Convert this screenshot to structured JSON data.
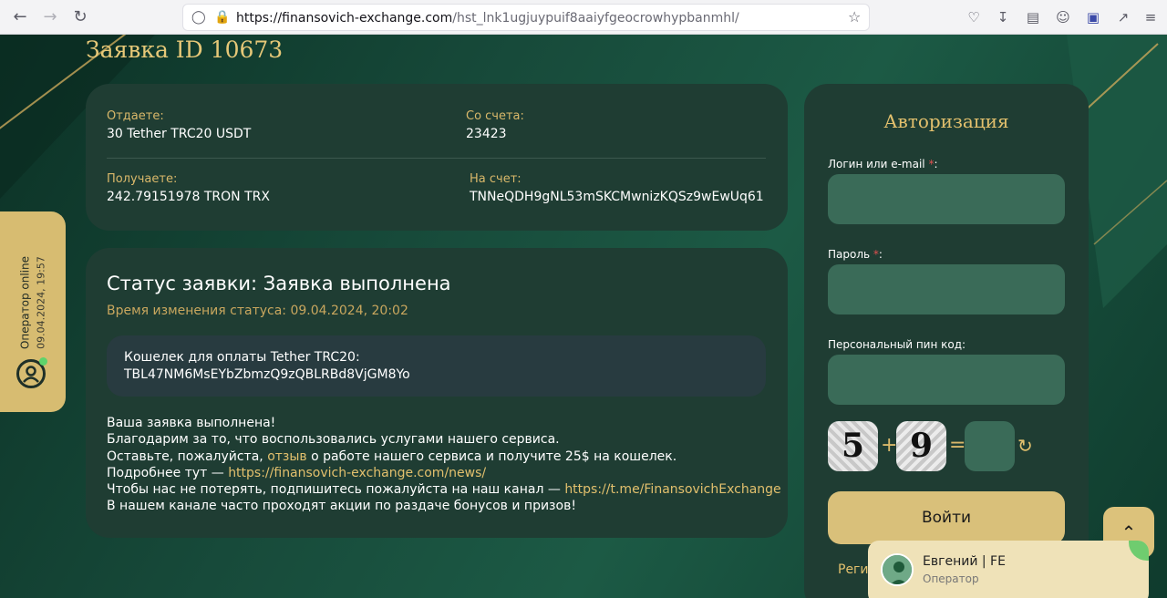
{
  "browser": {
    "url_host": "https://finansovich-exchange.com",
    "url_path": "/hst_lnk1ugjuypuif8aaiyfgeocrowhypbanmhl/"
  },
  "order": {
    "title": "Заявка ID 10673",
    "give_label": "Отдаете:",
    "give_value": "30 Tether TRC20 USDT",
    "from_account_label": "Со счета:",
    "from_account_value": "23423",
    "receive_label": "Получаете:",
    "receive_value": "242.79151978 TRON TRX",
    "to_account_label": "На счет:",
    "to_account_value": "TNNeQDH9gNL53mSKCMwnizKQSz9wEwUq61"
  },
  "status": {
    "title": "Статус заявки: Заявка выполнена",
    "changed": "Время изменения статуса: 09.04.2024, 20:02",
    "wallet_label": "Кошелек для оплаты Tether TRC20:",
    "wallet_value": "TBL47NM6MsEYbZbmzQ9zQBLRBd8VjGM8Yo",
    "line1": "Ваша заявка выполнена!",
    "line2": "Благодарим за то, что воспользовались услугами нашего сервиса.",
    "line3_pre": "Оставьте, пожалуйста,",
    "line3_link": "отзыв",
    "line3_post": "о работе нашего сервиса и получите 25$ на кошелек.",
    "line4_pre": "Подробнее тут —",
    "line4_link": "https://finansovich-exchange.com/news/",
    "line5_pre": "Чтобы нас не потерять, подпишитесь пожалуйста на наш канал —",
    "line5_link": "https://t.me/FinansovichExchange",
    "line6": "В нашем канале часто проходят акции по раздаче бонусов и призов!"
  },
  "auth": {
    "title": "Авторизация",
    "login_label": "Логин или e-mail",
    "password_label": "Пароль",
    "pin_label": "Персональный пин код:",
    "required_mark": "*",
    "colon": ":",
    "captcha_a": "5",
    "captcha_b": "9",
    "plus": "+",
    "equals": "=",
    "submit": "Войти",
    "register_link": "Регис"
  },
  "operator_tab": {
    "status": "Оператор online",
    "time": "09.04.2024, 19:57"
  },
  "chat": {
    "name": "Евгений | FE",
    "role": "Оператор"
  },
  "colors": {
    "accent_gold": "#e2c06d",
    "card": "#1f3d33",
    "input": "#3a6b58"
  }
}
